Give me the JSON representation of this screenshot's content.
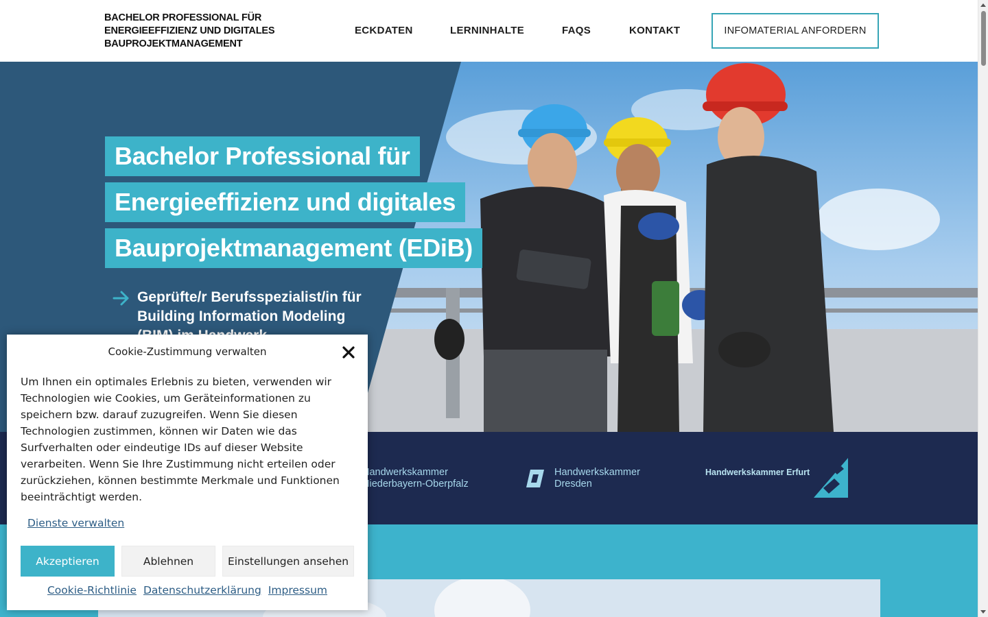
{
  "header": {
    "site_title": "BACHELOR PROFESSIONAL FÜR ENERGIEEFFIZIENZ UND DIGITALES BAUPROJEKTMANAGEMENT",
    "nav": [
      {
        "label": "ECKDATEN"
      },
      {
        "label": "LERNINHALTE"
      },
      {
        "label": "FAQS"
      },
      {
        "label": "KONTAKT"
      }
    ],
    "cta_label": "INFOMATERIAL ANFORDERN"
  },
  "hero": {
    "title_lines": [
      "Bachelor Professional für",
      "Energieeffizienz und digitales",
      "Bauprojektmanagement (EDiB)"
    ],
    "subtitle": "Geprüfte/r Berufsspezialist/in für Building Information Modeling (BIM) im Handwerk"
  },
  "partners": [
    {
      "label": "Handwerkskammer Niederbayern-Oberpfalz"
    },
    {
      "label": "Handwerkskammer Dresden"
    },
    {
      "label": "Handwerkskammer Erfurt"
    }
  ],
  "cookie": {
    "title": "Cookie-Zustimmung verwalten",
    "text": "Um Ihnen ein optimales Erlebnis zu bieten, verwenden wir Technologien wie Cookies, um Geräteinformationen zu speichern bzw. darauf zuzugreifen. Wenn Sie diesen Technologien zustimmen, können wir Daten wie das Surfverhalten oder eindeutige IDs auf dieser Website verarbeiten. Wenn Sie Ihre Zustimmung nicht erteilen oder zurückziehen, können bestimmte Merkmale und Funktionen beeinträchtigt werden.",
    "manage_link": "Dienste verwalten",
    "accept": "Akzeptieren",
    "deny": "Ablehnen",
    "settings": "Einstellungen ansehen",
    "links": [
      "Cookie-Richtlinie",
      "Datenschutzerklärung",
      "Impressum"
    ]
  },
  "colors": {
    "accent": "#3db3c9",
    "hero_panel": "#2d587a",
    "partner_band": "#1d2a50"
  }
}
